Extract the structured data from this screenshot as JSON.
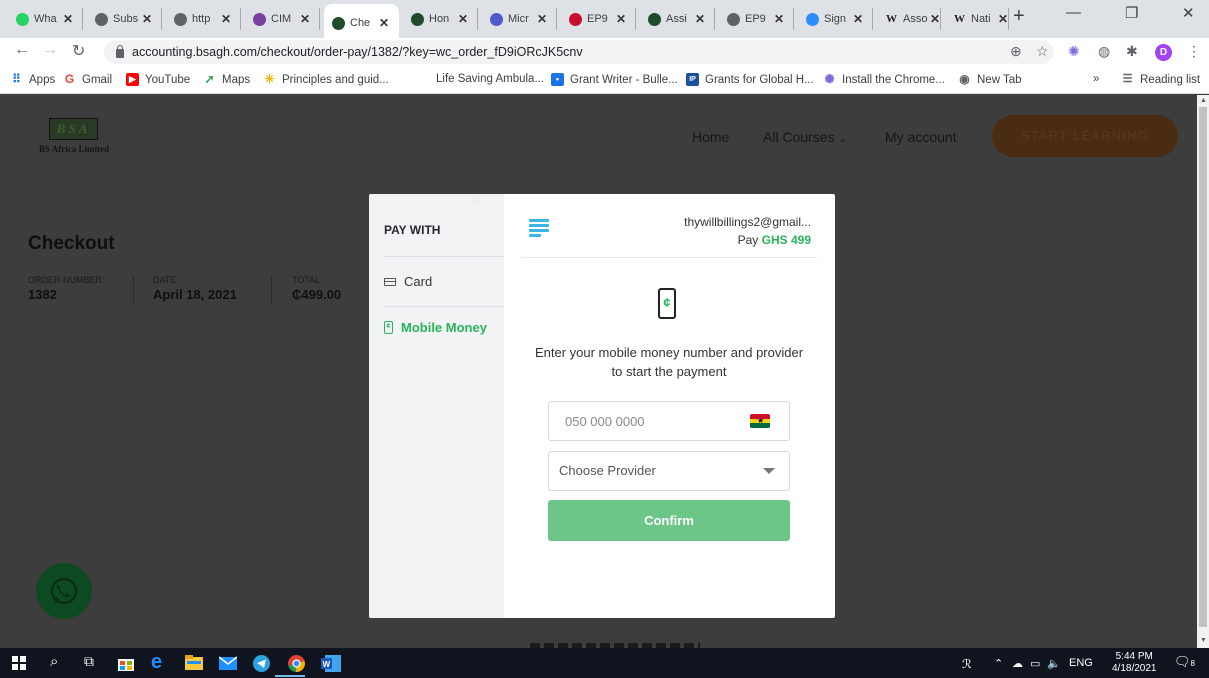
{
  "browser": {
    "tabs": [
      {
        "label": "Wha",
        "favicon": "whatsapp-icon",
        "color": "#25d366"
      },
      {
        "label": "Subs",
        "favicon": "globe-icon",
        "color": "#5f6368"
      },
      {
        "label": "http",
        "favicon": "globe-icon",
        "color": "#5f6368"
      },
      {
        "label": "CIM",
        "favicon": "cima-icon",
        "color": "#7b3fa0"
      },
      {
        "label": "Che",
        "favicon": "bsa-icon",
        "color": "#1f4d2b",
        "active": true
      },
      {
        "label": "Hon",
        "favicon": "bsa-icon",
        "color": "#1f4d2b"
      },
      {
        "label": "Micr",
        "favicon": "teams-icon",
        "color": "#5059c9"
      },
      {
        "label": "EP9",
        "favicon": "acca-icon",
        "color": "#c8102e"
      },
      {
        "label": "Assi",
        "favicon": "bsa-icon",
        "color": "#1f4d2b"
      },
      {
        "label": "EP9",
        "favicon": "globe-icon",
        "color": "#5f6368"
      },
      {
        "label": "Sign",
        "favicon": "zoom-icon",
        "color": "#2d8cff"
      },
      {
        "label": "Asso",
        "favicon": "wikipedia-icon",
        "color": "#ffffff"
      },
      {
        "label": "Nati",
        "favicon": "wikipedia-icon",
        "color": "#ffffff"
      }
    ],
    "url": "accounting.bsagh.com/checkout/order-pay/1382/?key=wc_order_fD9iORcJK5cnv",
    "bookmarks": [
      {
        "label": "Apps",
        "icon": "apps-grid-icon"
      },
      {
        "label": "Gmail",
        "icon": "google-icon"
      },
      {
        "label": "YouTube",
        "icon": "youtube-icon"
      },
      {
        "label": "Maps",
        "icon": "maps-icon"
      },
      {
        "label": "Principles and guid...",
        "icon": "sun-icon"
      },
      {
        "label": "Life Saving Ambula...",
        "icon": "none"
      },
      {
        "label": "Grant Writer - Bulle...",
        "icon": "doc-icon"
      },
      {
        "label": "Grants for Global H...",
        "icon": "ip-icon"
      },
      {
        "label": "Install the Chrome...",
        "icon": "extension-icon"
      },
      {
        "label": "New Tab",
        "icon": "globe-icon"
      }
    ],
    "reading_list": "Reading list",
    "profile_initial": "D"
  },
  "site": {
    "logo_text": "BSA",
    "logo_sub": "BS Africa Limited",
    "nav": {
      "home": "Home",
      "all_courses": "All Courses",
      "my_account": "My account"
    },
    "cta": "START LEARNING",
    "checkout_title": "Checkout",
    "order": {
      "number_label": "ORDER NUMBER:",
      "number": "1382",
      "date_label": "DATE:",
      "date": "April 18, 2021",
      "total_label": "TOTAL:",
      "total": "₵499.00"
    }
  },
  "payment_modal": {
    "pay_with": "PAY WITH",
    "options": [
      {
        "label": "Card",
        "selected": false
      },
      {
        "label": "Mobile Money",
        "selected": true
      }
    ],
    "email": "thywillbillings2@gmail...",
    "pay_prefix": "Pay",
    "amount": "GHS 499",
    "instruction": "Enter your mobile money number and provider to start the payment",
    "phone_placeholder": "050 000 0000",
    "provider_placeholder": "Choose Provider",
    "confirm": "Confirm",
    "accent_color": "#29b35b"
  },
  "taskbar": {
    "language": "ENG",
    "time": "5:44 PM",
    "date": "4/18/2021",
    "notifications": "8"
  }
}
